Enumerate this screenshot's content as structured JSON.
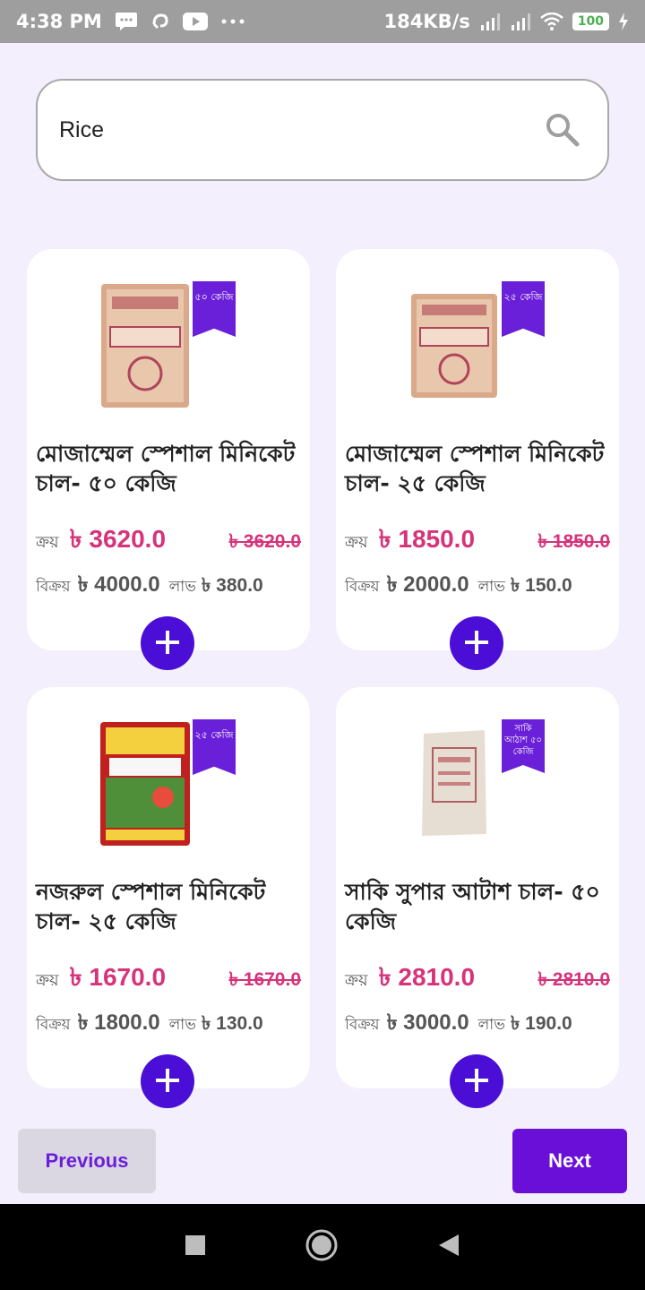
{
  "status_bar": {
    "time": "4:38 PM",
    "network_speed": "184KB/s",
    "battery": "100",
    "icons": [
      "message-icon",
      "swirl-icon",
      "youtube-icon",
      "more-icon",
      "signal-icon",
      "signal-icon",
      "wifi-icon",
      "battery-icon",
      "charging-icon"
    ]
  },
  "search": {
    "value": "Rice",
    "icon": "search-icon"
  },
  "labels": {
    "buy": "ক্রয়",
    "sell": "বিক্রয়",
    "profit": "লাভ"
  },
  "products": [
    {
      "name": "মোজাম্মেল স্পেশাল মিনিকেট চাল- ৫০ কেজি",
      "badge": "৫০ কেজি",
      "buy_price": "৳ 3620.0",
      "old_price": "৳ 3620.0",
      "sell_price": "৳ 4000.0",
      "profit": "৳ 380.0"
    },
    {
      "name": "মোজাম্মেল স্পেশাল মিনিকেট চাল- ২৫ কেজি",
      "badge": "২৫ কেজি",
      "buy_price": "৳ 1850.0",
      "old_price": "৳ 1850.0",
      "sell_price": "৳ 2000.0",
      "profit": "৳ 150.0"
    },
    {
      "name": "নজরুল স্পেশাল মিনিকেট চাল- ২৫ কেজি",
      "badge": "২৫ কেজি",
      "buy_price": "৳ 1670.0",
      "old_price": "৳ 1670.0",
      "sell_price": "৳ 1800.0",
      "profit": "৳ 130.0"
    },
    {
      "name": "সাকি সুপার আটাশ চাল- ৫০ কেজি",
      "badge": "সাকি আঠাশ ৫০ কেজি",
      "buy_price": "৳ 2810.0",
      "old_price": "৳ 2810.0",
      "sell_price": "৳ 3000.0",
      "profit": "৳ 190.0"
    }
  ],
  "pagination": {
    "previous": "Previous",
    "next": "Next"
  },
  "colors": {
    "accent": "#6a0fd8",
    "price": "#d6337a",
    "background": "#f3effd"
  }
}
